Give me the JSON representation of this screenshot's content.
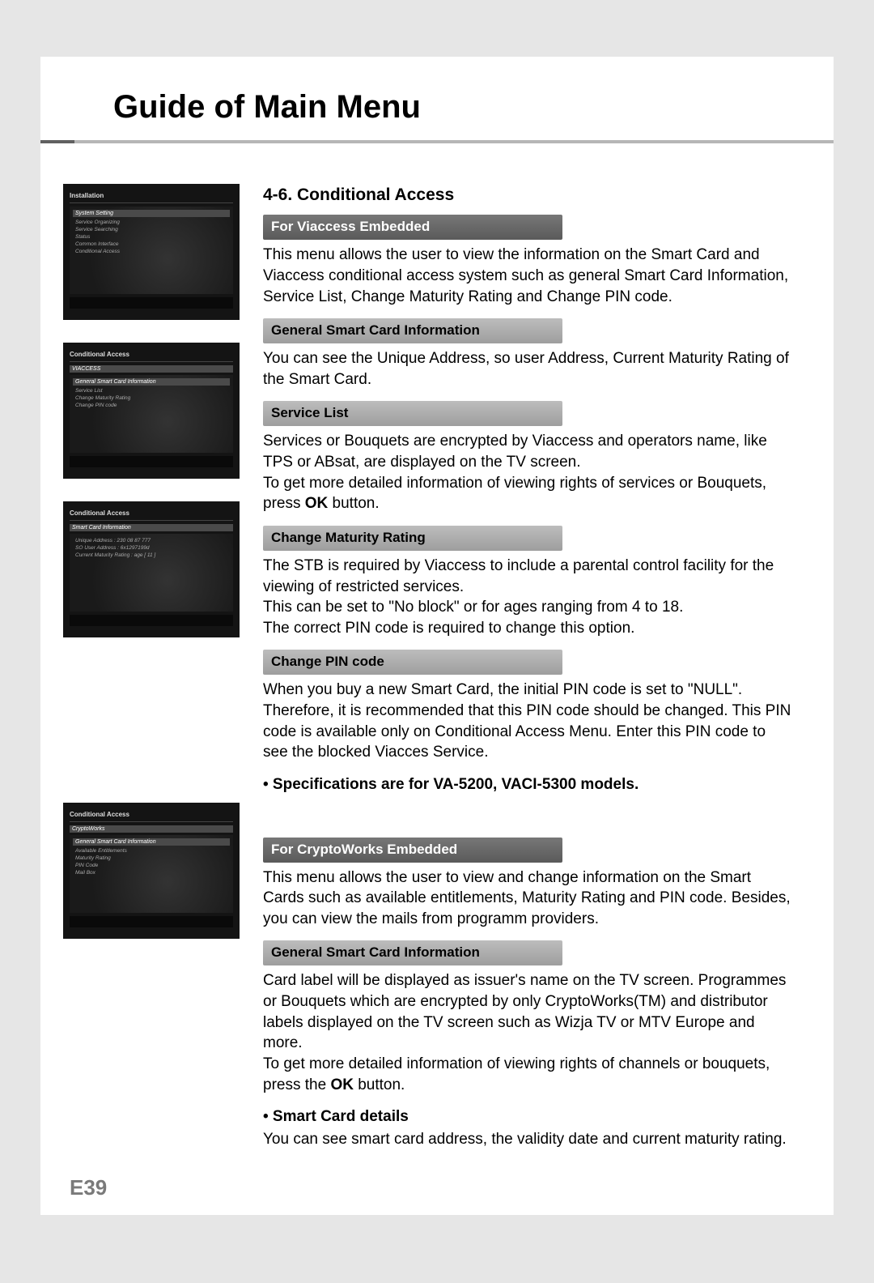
{
  "header": {
    "title": "Guide of Main Menu"
  },
  "page_number": "E39",
  "section": {
    "title": "4-6. Conditional Access"
  },
  "viaccess": {
    "bar": "For Viaccess Embedded",
    "intro": "This menu allows the user to view the information on the Smart Card and Viaccess conditional access system such as general Smart Card Information, Service List, Change Maturity Rating and Change PIN code.",
    "gsci_bar": "General Smart Card Information",
    "gsci_text": "You can see the Unique Address, so user Address, Current Maturity Rating of the Smart Card.",
    "sl_bar": "Service List",
    "sl_text1": "Services or Bouquets are encrypted by Viaccess and operators name, like TPS or ABsat, are displayed on the TV screen.",
    "sl_text2a": "To get more detailed information of viewing rights of services or Bouquets, press ",
    "sl_ok": "OK",
    "sl_text2b": " button.",
    "cmr_bar": "Change Maturity Rating",
    "cmr_text1": "The STB is required by Viaccess to include a parental control facility for the viewing of restricted services.",
    "cmr_text2": "This can be set to \"No block\" or for ages ranging from 4 to 18.",
    "cmr_text3": "The correct PIN code is required to change this option.",
    "cpin_bar": "Change PIN code",
    "cpin_text": "When you buy a new Smart Card, the initial PIN code is set to \"NULL\". Therefore, it is recommended that this PIN code should be changed. This PIN code is available only on Conditional Access Menu. Enter this PIN code to see the blocked Viacces Service.",
    "spec_note": "• Specifications are for VA-5200, VACI-5300 models."
  },
  "crypto": {
    "bar": "For CryptoWorks Embedded",
    "intro": "This menu allows the user to view and change information on the Smart Cards such as available entitlements, Maturity Rating and PIN code. Besides, you can view the mails from programm providers.",
    "gsci_bar": "General Smart Card Information",
    "gsci_text1": "Card label will be displayed as issuer's name on the TV screen. Programmes or Bouquets which are encrypted by only CryptoWorks(TM) and distributor labels displayed on the TV screen such as Wizja TV or MTV Europe and more.",
    "gsci_text2a": "To get more detailed information of viewing rights of channels or bouquets, press the ",
    "gsci_ok": "OK",
    "gsci_text2b": " button.",
    "scd_heading": "• Smart Card details",
    "scd_text": "You can see smart card address, the validity date and current maturity rating."
  },
  "tv1": {
    "title": "Installation",
    "hl": "System Setting",
    "items": [
      "Service Organizing",
      "Service Searching",
      "Status",
      "Common Interface",
      "Conditional Access"
    ]
  },
  "tv2": {
    "title": "Conditional Access",
    "sub": "VIACCESS",
    "hl": "General Smart Card Information",
    "items": [
      "Service List",
      "Change Maturity Rating",
      "Change PIN code"
    ]
  },
  "tv3": {
    "title": "Conditional Access",
    "sub": "Smart Card Information",
    "rows": [
      "Unique Address      : 230 08 87 777",
      "SO User Address    : 6x1297199d",
      "Current Maturity Rating : age [ 11 ]"
    ]
  },
  "tv4": {
    "title": "Conditional Access",
    "sub": "CryptoWorks",
    "hl": "General Smart Card Information",
    "items": [
      "Available Entitlements",
      "Maturity Rating",
      "PIN Code",
      "Mail Box"
    ]
  }
}
